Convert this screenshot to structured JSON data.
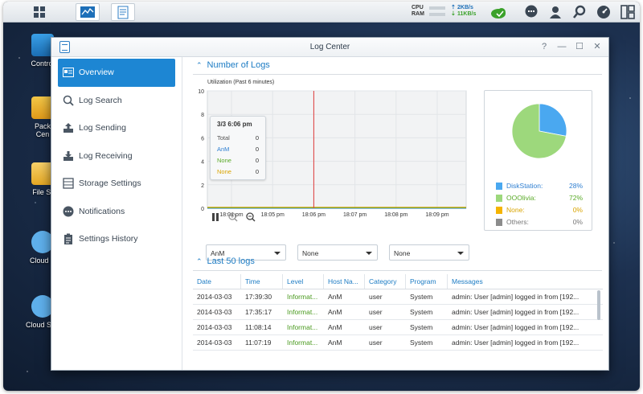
{
  "taskbar": {
    "cpu_label": "CPU",
    "ram_label": "RAM",
    "upload": "2KB/s",
    "download": "11KB/s"
  },
  "desktop_icons": [
    {
      "label": "Control"
    },
    {
      "label": "Pack"
    },
    {
      "label": "Cen"
    },
    {
      "label": "File St"
    },
    {
      "label": "Cloud S"
    },
    {
      "label": "Cloud Stat"
    }
  ],
  "window": {
    "title": "Log Center",
    "help": "?",
    "minimize": "—",
    "maximize": "☐",
    "close": "✕"
  },
  "sidebar": {
    "items": [
      {
        "label": "Overview",
        "icon": "overview-icon"
      },
      {
        "label": "Log Search",
        "icon": "search-icon"
      },
      {
        "label": "Log Sending",
        "icon": "upload-icon"
      },
      {
        "label": "Log Receiving",
        "icon": "download-icon"
      },
      {
        "label": "Storage Settings",
        "icon": "storage-icon"
      },
      {
        "label": "Notifications",
        "icon": "chat-icon"
      },
      {
        "label": "Settings History",
        "icon": "clipboard-icon"
      }
    ]
  },
  "number_of_logs": {
    "heading": "Number of Logs",
    "utilization_label": "Utilization (Past 6 minutes)",
    "tooltip": {
      "time": "3/3 6:06 pm",
      "rows": [
        {
          "label": "Total",
          "value": "0",
          "color": "#555555"
        },
        {
          "label": "AnM",
          "value": "0",
          "color": "#2f7fd1"
        },
        {
          "label": "None",
          "value": "0",
          "color": "#5aaa28"
        },
        {
          "label": "None",
          "value": "0",
          "color": "#d9a400"
        }
      ]
    },
    "filters": [
      "AnM",
      "None",
      "None"
    ]
  },
  "chart_data": {
    "type": "line",
    "x": [
      "18:04 pm",
      "18:05 pm",
      "18:06 pm",
      "18:07 pm",
      "18:08 pm",
      "18:09 pm"
    ],
    "ylim": [
      0,
      10
    ],
    "yticks": [
      0,
      2,
      4,
      6,
      8,
      10
    ],
    "series": [
      {
        "name": "AnM",
        "values": [
          0,
          0,
          0,
          0,
          0,
          0
        ],
        "color": "#2f7fd1"
      },
      {
        "name": "None",
        "values": [
          0,
          0,
          0,
          0,
          0,
          0
        ],
        "color": "#5aaa28"
      },
      {
        "name": "None",
        "values": [
          0,
          0,
          0,
          0,
          0,
          0
        ],
        "color": "#d9a400"
      }
    ],
    "cursor_at": "18:06 pm"
  },
  "pie": {
    "slices": [
      {
        "name": "DiskStation:",
        "value": 28,
        "label": "28%",
        "color": "#4aa8f0"
      },
      {
        "name": "OOOlivia:",
        "value": 72,
        "label": "72%",
        "color": "#9dd87c"
      },
      {
        "name": "None:",
        "value": 0,
        "label": "0%",
        "color": "#f5b400"
      },
      {
        "name": "Others:",
        "value": 0,
        "label": "0%",
        "color": "#8c8c8c"
      }
    ]
  },
  "last_logs": {
    "heading": "Last 50 logs",
    "columns": [
      "Date",
      "Time",
      "Level",
      "Host Na...",
      "Category",
      "Program",
      "Messages"
    ],
    "rows": [
      [
        "2014-03-03",
        "17:39:30",
        "Informat...",
        "AnM",
        "user",
        "System",
        "admin: User [admin] logged in from [192..."
      ],
      [
        "2014-03-03",
        "17:35:17",
        "Informat...",
        "AnM",
        "user",
        "System",
        "admin: User [admin] logged in from [192..."
      ],
      [
        "2014-03-03",
        "11:08:14",
        "Informat...",
        "AnM",
        "user",
        "System",
        "admin: User [admin] logged in from [192..."
      ],
      [
        "2014-03-03",
        "11:07:19",
        "Informat...",
        "AnM",
        "user",
        "System",
        "admin: User [admin] logged in from [192..."
      ]
    ]
  }
}
